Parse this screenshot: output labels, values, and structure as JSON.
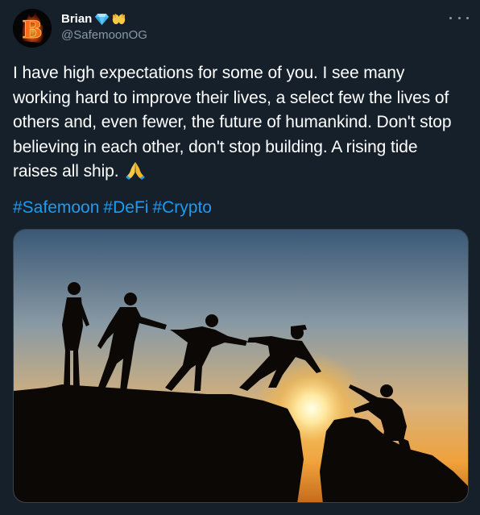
{
  "author": {
    "name": "Brian",
    "handle": "@SafemoonOG",
    "avatar_letter": "B",
    "badges": [
      "gem-icon",
      "open-hands-icon"
    ]
  },
  "tweet": {
    "text": "I have high expectations for some of you. I see many working hard to improve their lives, a select few the lives of others and, even fewer, the future of humankind. Don't stop believing in each other, don't stop building. A rising tide raises all ship.",
    "emoji_icon": "praying-hands-icon",
    "hashtags": [
      "#Safemoon",
      "#DeFi",
      "#Crypto"
    ]
  },
  "media": {
    "description_icon": "silhouettes-helping-climb-photo"
  },
  "colors": {
    "background": "#15202b",
    "link": "#1d9bf0",
    "secondary_text": "#8899a6"
  }
}
